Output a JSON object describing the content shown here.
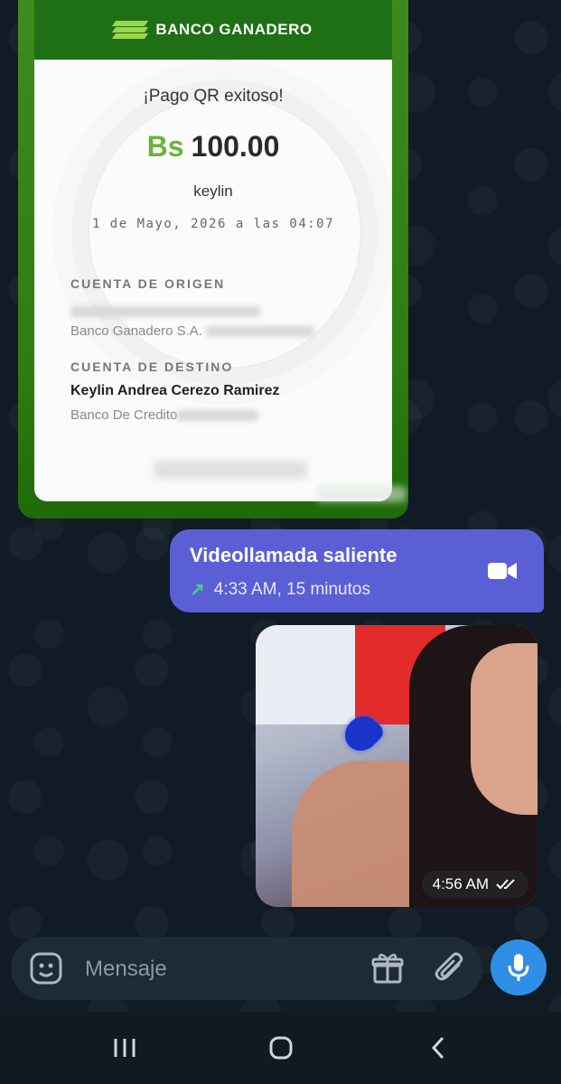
{
  "receipt": {
    "bank_name": "BANCO GANADERO",
    "title": "¡Pago QR exitoso!",
    "currency": "Bs",
    "amount": "100.00",
    "payee": "keylin",
    "datetime": "1 de Mayo, 2026 a las 04:07",
    "origin_label": "CUENTA DE ORIGEN",
    "origin_bank": "Banco Ganadero S.A.",
    "dest_label": "CUENTA DE DESTINO",
    "dest_name": "Keylin Andrea Cerezo Ramirez",
    "dest_bank": "Banco De Credito",
    "colors": {
      "brand_green": "#3d8b1d",
      "amount_green": "#6bb33a"
    }
  },
  "call": {
    "title": "Videollamada saliente",
    "info": "4:33 AM, 15 minutos",
    "icon": "video-camera-icon",
    "bubble_color": "#5b5fd6"
  },
  "photo": {
    "time": "4:56 AM",
    "status_icon": "double-check-icon"
  },
  "composer": {
    "placeholder": "Mensaje",
    "mic_color": "#2f8fe6"
  }
}
